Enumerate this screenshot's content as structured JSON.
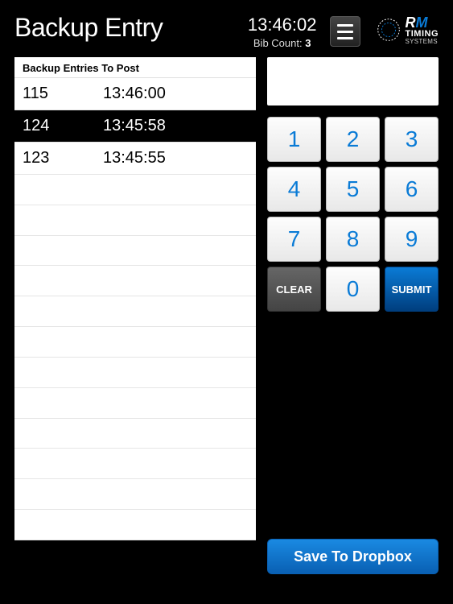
{
  "header": {
    "title": "Backup Entry",
    "clock": "13:46:02",
    "bib_count_label": "Bib Count:",
    "bib_count_value": "3"
  },
  "logo": {
    "line1_r": "R",
    "line1_m": "M",
    "line2": "TIMING",
    "line3": "SYSTEMS"
  },
  "list": {
    "header": "Backup Entries To Post",
    "entries": [
      {
        "bib": "115",
        "time": "13:46:00",
        "selected": false
      },
      {
        "bib": "124",
        "time": "13:45:58",
        "selected": true
      },
      {
        "bib": "123",
        "time": "13:45:55",
        "selected": false
      }
    ]
  },
  "keypad": {
    "keys": [
      "1",
      "2",
      "3",
      "4",
      "5",
      "6",
      "7",
      "8",
      "9"
    ],
    "clear": "CLEAR",
    "zero": "0",
    "submit": "SUBMIT"
  },
  "save_button": "Save To Dropbox",
  "input_value": ""
}
